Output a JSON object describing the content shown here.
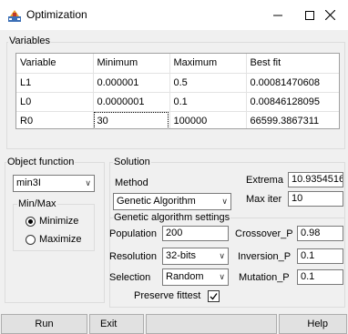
{
  "window": {
    "title": "Optimization",
    "icon": "app-icon",
    "controls": [
      "minimize-icon",
      "maximize-icon",
      "close-icon"
    ]
  },
  "variables": {
    "group_label": "Variables",
    "columns": [
      "Variable",
      "Minimum",
      "Maximum",
      "Best fit"
    ],
    "rows": [
      [
        "L1",
        "0.000001",
        "0.5",
        "0.00081470608"
      ],
      [
        "L0",
        "0.0000001",
        "0.1",
        "0.00846128095"
      ],
      [
        "R0",
        "30",
        "100000",
        "66599.3867311"
      ]
    ]
  },
  "object_function": {
    "group_label": "Object function",
    "selected": "min3I",
    "minmax_label": "Min/Max",
    "options": [
      {
        "label": "Minimize",
        "checked": true
      },
      {
        "label": "Maximize",
        "checked": false
      }
    ]
  },
  "solution": {
    "group_label": "Solution",
    "method_label": "Method",
    "method_value": "Genetic Algorithm",
    "extrema_label": "Extrema",
    "extrema_value": "10.9354516",
    "max_iter_label": "Max iter",
    "max_iter_value": "10",
    "ga_settings_label": "Genetic algorithm settings",
    "population_label": "Population",
    "population_value": "200",
    "resolution_label": "Resolution",
    "resolution_value": "32-bits",
    "selection_label": "Selection",
    "selection_value": "Random",
    "crossover_label": "Crossover_P",
    "crossover_value": "0.98",
    "inversion_label": "Inversion_P",
    "inversion_value": "0.1",
    "mutation_label": "Mutation_P",
    "mutation_value": "0.1",
    "preserve_label": "Preserve fittest",
    "preserve_checked": true
  },
  "buttons": {
    "run": "Run",
    "exit": "Exit",
    "help": "Help"
  }
}
